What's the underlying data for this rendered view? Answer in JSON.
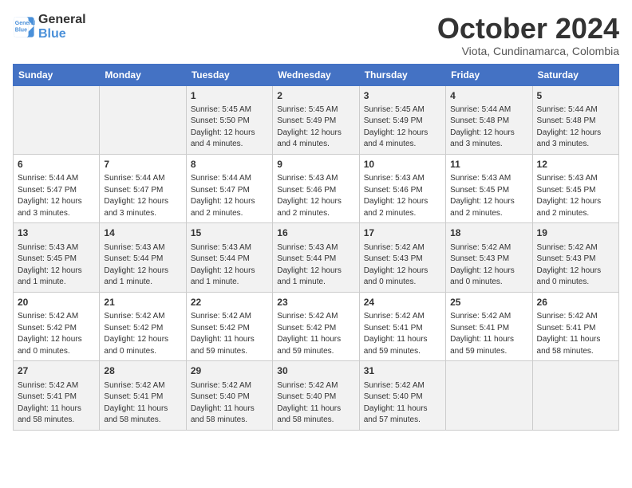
{
  "logo": {
    "line1": "General",
    "line2": "Blue"
  },
  "title": "October 2024",
  "subtitle": "Viota, Cundinamarca, Colombia",
  "headers": [
    "Sunday",
    "Monday",
    "Tuesday",
    "Wednesday",
    "Thursday",
    "Friday",
    "Saturday"
  ],
  "weeks": [
    [
      {
        "day": "",
        "info": ""
      },
      {
        "day": "",
        "info": ""
      },
      {
        "day": "1",
        "info": "Sunrise: 5:45 AM\nSunset: 5:50 PM\nDaylight: 12 hours\nand 4 minutes."
      },
      {
        "day": "2",
        "info": "Sunrise: 5:45 AM\nSunset: 5:49 PM\nDaylight: 12 hours\nand 4 minutes."
      },
      {
        "day": "3",
        "info": "Sunrise: 5:45 AM\nSunset: 5:49 PM\nDaylight: 12 hours\nand 4 minutes."
      },
      {
        "day": "4",
        "info": "Sunrise: 5:44 AM\nSunset: 5:48 PM\nDaylight: 12 hours\nand 3 minutes."
      },
      {
        "day": "5",
        "info": "Sunrise: 5:44 AM\nSunset: 5:48 PM\nDaylight: 12 hours\nand 3 minutes."
      }
    ],
    [
      {
        "day": "6",
        "info": "Sunrise: 5:44 AM\nSunset: 5:47 PM\nDaylight: 12 hours\nand 3 minutes."
      },
      {
        "day": "7",
        "info": "Sunrise: 5:44 AM\nSunset: 5:47 PM\nDaylight: 12 hours\nand 3 minutes."
      },
      {
        "day": "8",
        "info": "Sunrise: 5:44 AM\nSunset: 5:47 PM\nDaylight: 12 hours\nand 2 minutes."
      },
      {
        "day": "9",
        "info": "Sunrise: 5:43 AM\nSunset: 5:46 PM\nDaylight: 12 hours\nand 2 minutes."
      },
      {
        "day": "10",
        "info": "Sunrise: 5:43 AM\nSunset: 5:46 PM\nDaylight: 12 hours\nand 2 minutes."
      },
      {
        "day": "11",
        "info": "Sunrise: 5:43 AM\nSunset: 5:45 PM\nDaylight: 12 hours\nand 2 minutes."
      },
      {
        "day": "12",
        "info": "Sunrise: 5:43 AM\nSunset: 5:45 PM\nDaylight: 12 hours\nand 2 minutes."
      }
    ],
    [
      {
        "day": "13",
        "info": "Sunrise: 5:43 AM\nSunset: 5:45 PM\nDaylight: 12 hours\nand 1 minute."
      },
      {
        "day": "14",
        "info": "Sunrise: 5:43 AM\nSunset: 5:44 PM\nDaylight: 12 hours\nand 1 minute."
      },
      {
        "day": "15",
        "info": "Sunrise: 5:43 AM\nSunset: 5:44 PM\nDaylight: 12 hours\nand 1 minute."
      },
      {
        "day": "16",
        "info": "Sunrise: 5:43 AM\nSunset: 5:44 PM\nDaylight: 12 hours\nand 1 minute."
      },
      {
        "day": "17",
        "info": "Sunrise: 5:42 AM\nSunset: 5:43 PM\nDaylight: 12 hours\nand 0 minutes."
      },
      {
        "day": "18",
        "info": "Sunrise: 5:42 AM\nSunset: 5:43 PM\nDaylight: 12 hours\nand 0 minutes."
      },
      {
        "day": "19",
        "info": "Sunrise: 5:42 AM\nSunset: 5:43 PM\nDaylight: 12 hours\nand 0 minutes."
      }
    ],
    [
      {
        "day": "20",
        "info": "Sunrise: 5:42 AM\nSunset: 5:42 PM\nDaylight: 12 hours\nand 0 minutes."
      },
      {
        "day": "21",
        "info": "Sunrise: 5:42 AM\nSunset: 5:42 PM\nDaylight: 12 hours\nand 0 minutes."
      },
      {
        "day": "22",
        "info": "Sunrise: 5:42 AM\nSunset: 5:42 PM\nDaylight: 11 hours\nand 59 minutes."
      },
      {
        "day": "23",
        "info": "Sunrise: 5:42 AM\nSunset: 5:42 PM\nDaylight: 11 hours\nand 59 minutes."
      },
      {
        "day": "24",
        "info": "Sunrise: 5:42 AM\nSunset: 5:41 PM\nDaylight: 11 hours\nand 59 minutes."
      },
      {
        "day": "25",
        "info": "Sunrise: 5:42 AM\nSunset: 5:41 PM\nDaylight: 11 hours\nand 59 minutes."
      },
      {
        "day": "26",
        "info": "Sunrise: 5:42 AM\nSunset: 5:41 PM\nDaylight: 11 hours\nand 58 minutes."
      }
    ],
    [
      {
        "day": "27",
        "info": "Sunrise: 5:42 AM\nSunset: 5:41 PM\nDaylight: 11 hours\nand 58 minutes."
      },
      {
        "day": "28",
        "info": "Sunrise: 5:42 AM\nSunset: 5:41 PM\nDaylight: 11 hours\nand 58 minutes."
      },
      {
        "day": "29",
        "info": "Sunrise: 5:42 AM\nSunset: 5:40 PM\nDaylight: 11 hours\nand 58 minutes."
      },
      {
        "day": "30",
        "info": "Sunrise: 5:42 AM\nSunset: 5:40 PM\nDaylight: 11 hours\nand 58 minutes."
      },
      {
        "day": "31",
        "info": "Sunrise: 5:42 AM\nSunset: 5:40 PM\nDaylight: 11 hours\nand 57 minutes."
      },
      {
        "day": "",
        "info": ""
      },
      {
        "day": "",
        "info": ""
      }
    ]
  ]
}
